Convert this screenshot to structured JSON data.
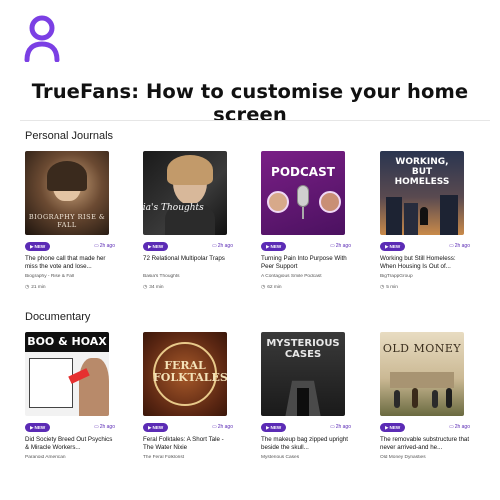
{
  "brand": {
    "accent": "#6a2fd8",
    "badge_color": "#5b2bb5"
  },
  "headline": "TrueFans: How to customise your home screen",
  "sections": [
    {
      "title": "Personal Journals",
      "cards": [
        {
          "badge": "NEW",
          "ago": "2h ago",
          "title": "The phone call that made her miss the vote and lose...",
          "author": "Biography - Rise & Fall",
          "duration": "21 min",
          "art_text": "BIOGRAPHY RISE & FALL"
        },
        {
          "badge": "NEW",
          "ago": "2h ago",
          "title": "72 Relational Multipolar Traps",
          "author": "Basia's Thoughts",
          "duration": "34 min",
          "art_text": "Basia's Thoughts"
        },
        {
          "badge": "NEW",
          "ago": "2h ago",
          "title": "Turning Pain Into Purpose With Peer Support",
          "author": "A Contagious Smile Podcast",
          "duration": "62 min",
          "art_text": "PODCAST"
        },
        {
          "badge": "NEW",
          "ago": "2h ago",
          "title": "Working but Still Homeless: When Housing Is Out of...",
          "author": "BigTrappGroup",
          "duration": "5 min",
          "art_text": "WORKING, BUT HOMELESS"
        }
      ]
    },
    {
      "title": "Documentary",
      "cards": [
        {
          "badge": "NEW",
          "ago": "2h ago",
          "title": "Did Society Breed Out Psychics & Miracle Workers...",
          "author": "Paranoid American",
          "duration": "",
          "art_text": "BOO & HOAX"
        },
        {
          "badge": "NEW",
          "ago": "2h ago",
          "title": "Feral Folktales: A Short Tale - The Water Nixie",
          "author": "The Feral Folklorist",
          "duration": "",
          "art_text": "FERAL FOLKTALES"
        },
        {
          "badge": "NEW",
          "ago": "2h ago",
          "title": "The makeup bag zipped upright beside the skull...",
          "author": "Mysterious Cases",
          "duration": "",
          "art_text": "MYSTERIOUS CASES"
        },
        {
          "badge": "NEW",
          "ago": "2h ago",
          "title": "The removable substructure that never arrived-and he...",
          "author": "Old Money Dynasties",
          "duration": "",
          "art_text": "OLD MONEY"
        }
      ]
    }
  ]
}
